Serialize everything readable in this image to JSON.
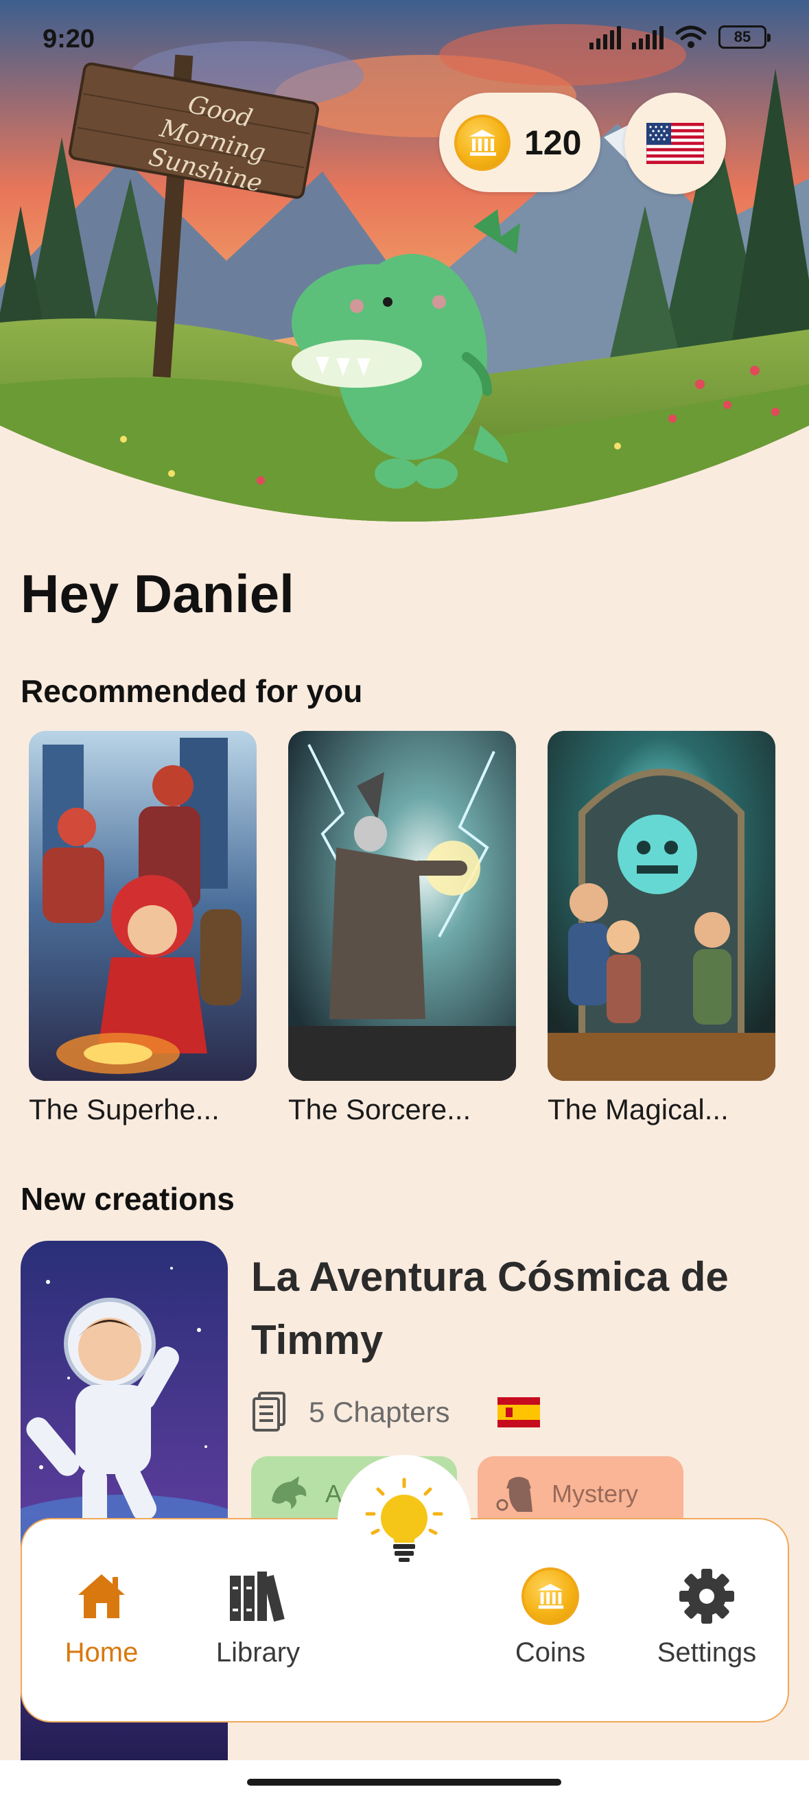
{
  "status_bar": {
    "time": "9:20",
    "battery": "85"
  },
  "hero": {
    "sign_text": [
      "Good Morning",
      "Sunshine"
    ],
    "coins": "120",
    "language_flag": "us-flag-icon"
  },
  "greeting": "Hey Daniel",
  "recommended": {
    "title": "Recommended for you",
    "items": [
      {
        "title": "The Superhe..."
      },
      {
        "title": "The Sorcere..."
      },
      {
        "title": "The Magical..."
      }
    ]
  },
  "new_creations": {
    "title": "New creations",
    "story": {
      "title": "La Aventura Cósmica de Timmy",
      "chapters": "5 Chapters",
      "language_flag": "spain-flag-icon",
      "tags": [
        {
          "label": "A",
          "icon": "dragon-icon",
          "color": "#b7e0a6"
        },
        {
          "label": "Mystery",
          "icon": "detective-icon",
          "color": "#f9b595"
        }
      ]
    }
  },
  "nav": {
    "items": [
      {
        "label": "Home",
        "icon": "home-icon",
        "active": true
      },
      {
        "label": "Library",
        "icon": "library-icon",
        "active": false
      },
      {
        "label": "Coins",
        "icon": "coin-icon",
        "active": false
      },
      {
        "label": "Settings",
        "icon": "gear-icon",
        "active": false
      }
    ],
    "center_icon": "lightbulb-icon"
  },
  "colors": {
    "background": "#faebdf",
    "accent": "#d9780e",
    "nav_border": "#f0a85a",
    "dino": "#5cc07a"
  }
}
